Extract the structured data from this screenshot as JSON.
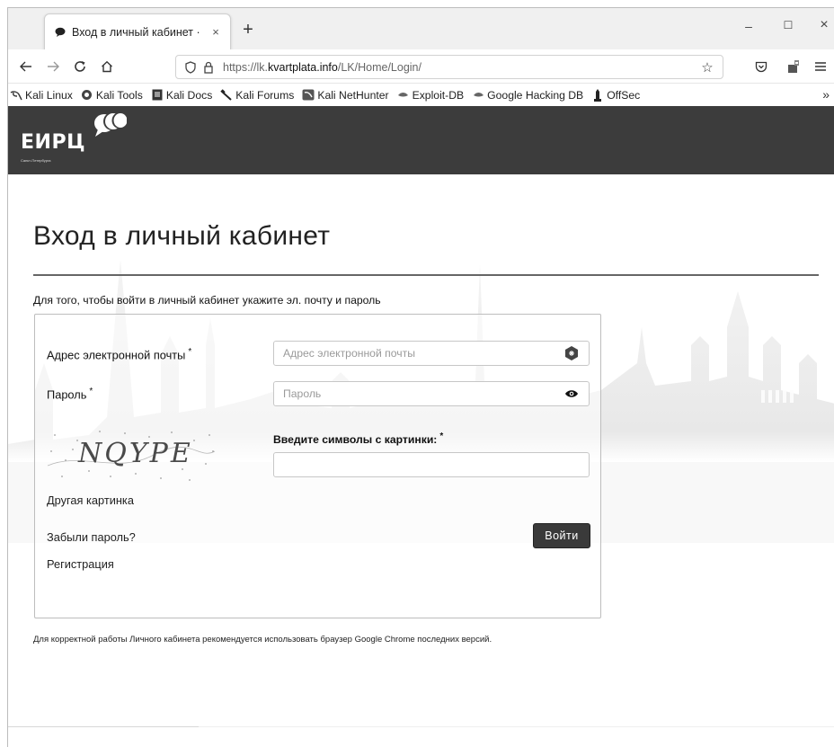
{
  "browser": {
    "tab_title": "Вход в личный кабинет ·",
    "tab_close": "×",
    "new_tab": "+",
    "window_minimize": "–",
    "window_maximize": "☐",
    "window_close": "×",
    "url_prefix": "https://lk.",
    "url_domain": "kvartplata.info",
    "url_path": "/LK/Home/Login/"
  },
  "bookmarks": [
    {
      "label": "Kali Linux",
      "icon": "kali-dragon-icon"
    },
    {
      "label": "Kali Tools",
      "icon": "kali-tools-icon"
    },
    {
      "label": "Kali Docs",
      "icon": "kali-docs-icon"
    },
    {
      "label": "Kali Forums",
      "icon": "kali-forums-icon"
    },
    {
      "label": "Kali NetHunter",
      "icon": "kali-nethunter-icon"
    },
    {
      "label": "Exploit-DB",
      "icon": "exploit-db-icon"
    },
    {
      "label": "Google Hacking DB",
      "icon": "ghdb-icon"
    },
    {
      "label": "OffSec",
      "icon": "offsec-icon"
    }
  ],
  "bookmarks_more": "»",
  "site": {
    "logo_text": "ЕИРЦ",
    "logo_subtext": "Санкт-Петербурга"
  },
  "page": {
    "title": "Вход в личный кабинет",
    "instruction": "Для того, чтобы войти в личный кабинет укажите эл. почту и пароль",
    "footnote": "Для корректной работы Личного кабинета рекомендуется использовать браузер Google Chrome последних версий."
  },
  "form": {
    "email_label": "Адрес электронной почты",
    "email_placeholder": "Адрес электронной почты",
    "password_label": "Пароль",
    "password_placeholder": "Пароль",
    "captcha_label": "Введите символы с картинки:",
    "captcha_text": "NQYPE",
    "captcha_value": "",
    "required_mark": "*",
    "refresh_captcha": "Другая картинка",
    "forgot_password": "Забыли пароль?",
    "register": "Регистрация",
    "submit": "Войти"
  }
}
